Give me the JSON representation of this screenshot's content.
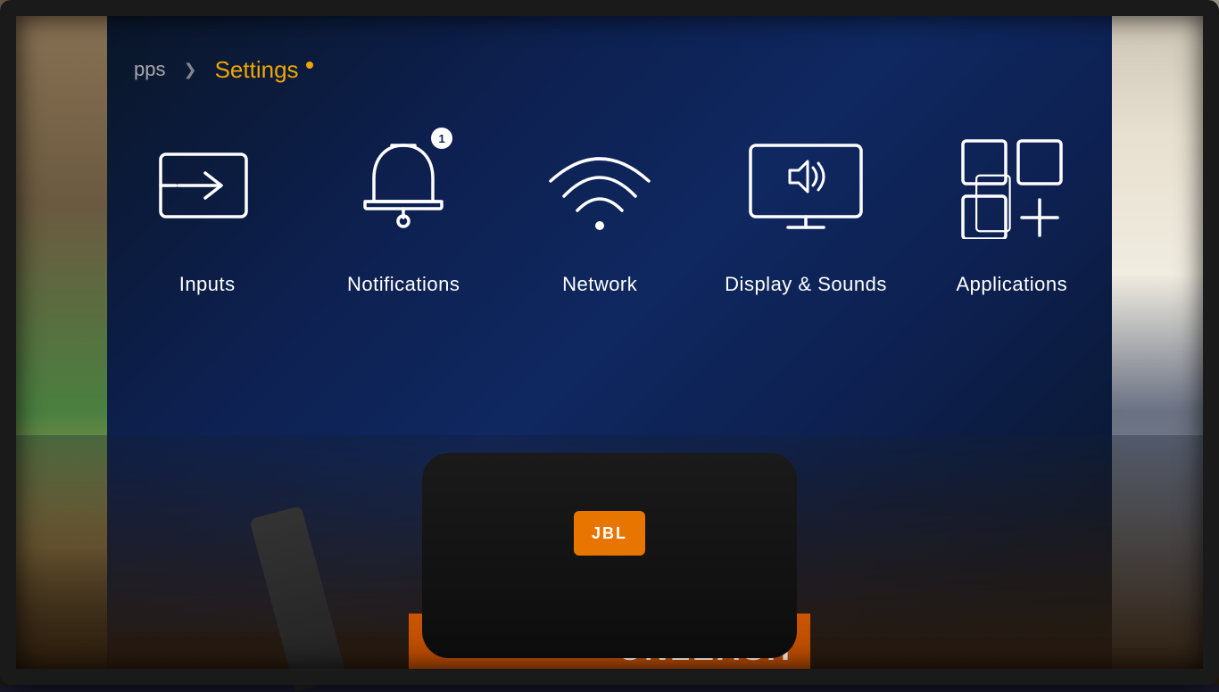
{
  "nav": {
    "apps_label": "pps",
    "settings_label": "Settings",
    "arrow": "❯"
  },
  "settings_items": [
    {
      "id": "inputs",
      "label": "Inputs",
      "icon": "input-arrow",
      "badge": null
    },
    {
      "id": "notifications",
      "label": "Notifications",
      "icon": "bell",
      "badge": "1"
    },
    {
      "id": "network",
      "label": "Network",
      "icon": "wifi",
      "badge": null
    },
    {
      "id": "display-sounds",
      "label": "Display & Sounds",
      "icon": "display-sound",
      "badge": null
    },
    {
      "id": "applications",
      "label": "Applications",
      "icon": "apps-grid",
      "badge": null
    }
  ],
  "bottom": {
    "jbl_text": "JBL",
    "unleash_text": "UNLEASH"
  },
  "colors": {
    "accent": "#f0a500",
    "bg": "#0d1b3e",
    "icon_stroke": "#ffffff",
    "nav_active": "#f0a500",
    "nav_inactive": "#cccccc"
  }
}
